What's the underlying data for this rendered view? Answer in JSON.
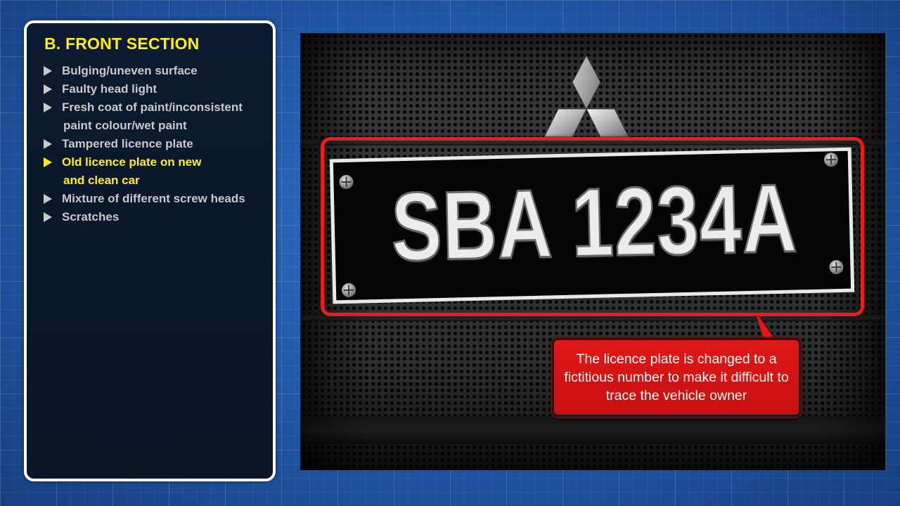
{
  "panel": {
    "title": "B. FRONT SECTION",
    "items": [
      {
        "line1": "Bulging/uneven surface",
        "line2": "",
        "active": false
      },
      {
        "line1": "Faulty head light",
        "line2": "",
        "active": false
      },
      {
        "line1": "Fresh coat of paint/inconsistent",
        "line2": "paint colour/wet paint",
        "active": false
      },
      {
        "line1": "Tampered licence plate",
        "line2": "",
        "active": false
      },
      {
        "line1": "Old licence plate on new",
        "line2": "and clean car",
        "active": true
      },
      {
        "line1": "Mixture of different screw heads",
        "line2": "",
        "active": false
      },
      {
        "line1": "Scratches",
        "line2": "",
        "active": false
      }
    ]
  },
  "photo": {
    "plate_number": "SBA 1234A",
    "logo_icon": "three-diamond-logo-icon"
  },
  "callout": {
    "text": "The licence plate is changed to a fictitious number to make it difficult to trace the vehicle owner"
  },
  "colors": {
    "title_yellow": "#ffee10",
    "highlight_red": "#ea1c1c",
    "item_grey": "#c9c9c9"
  }
}
